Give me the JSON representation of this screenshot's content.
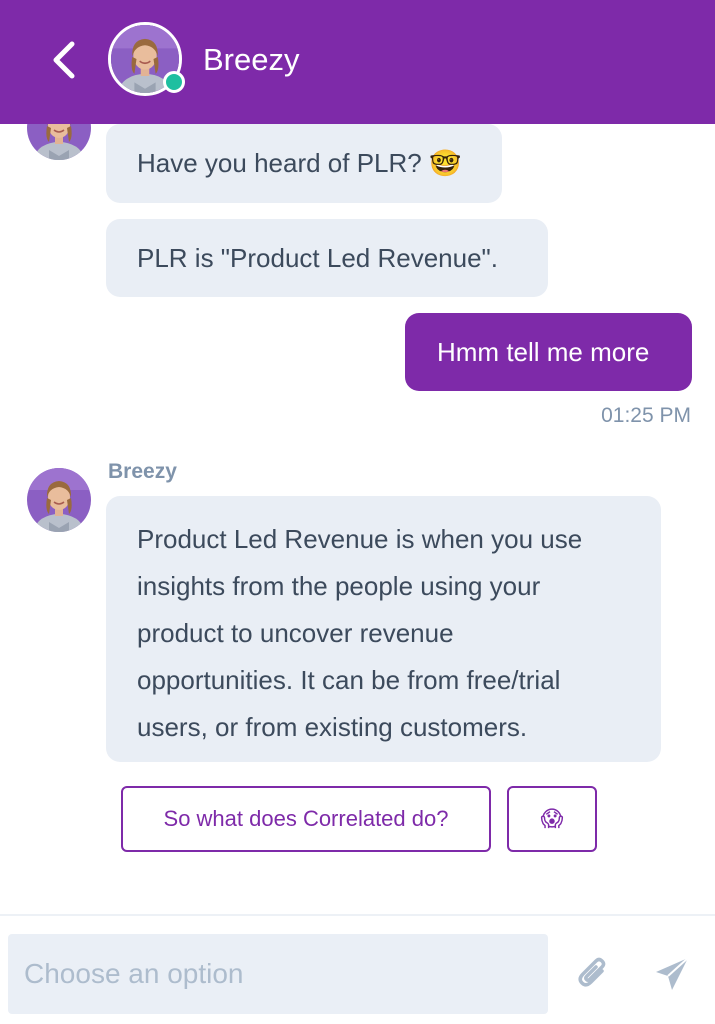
{
  "header": {
    "contact_name": "Breezy",
    "status": "online"
  },
  "messages": [
    {
      "from": "bot",
      "text": "Have you heard of PLR? 🤓"
    },
    {
      "from": "bot",
      "text": "PLR is \"Product Led Revenue\"."
    },
    {
      "from": "user",
      "text": "Hmm tell me more",
      "time": "01:25 PM"
    },
    {
      "from": "bot",
      "sender": "Breezy",
      "lines": [
        "Product Led Revenue is when you use",
        "insights from the people using your",
        "product to uncover revenue",
        "opportunities. It can be from free/trial",
        "users, or from existing customers."
      ]
    }
  ],
  "options": [
    {
      "label": "So what does Correlated do?"
    },
    {
      "label": "😱"
    }
  ],
  "composer": {
    "placeholder": "Choose an option",
    "attach_icon": "paperclip-icon",
    "send_icon": "send-icon"
  },
  "colors": {
    "brand": "#7e2aa9",
    "incoming_bubble": "#e9eef5",
    "online": "#1fbfa0",
    "muted_text": "#7f93ab"
  }
}
